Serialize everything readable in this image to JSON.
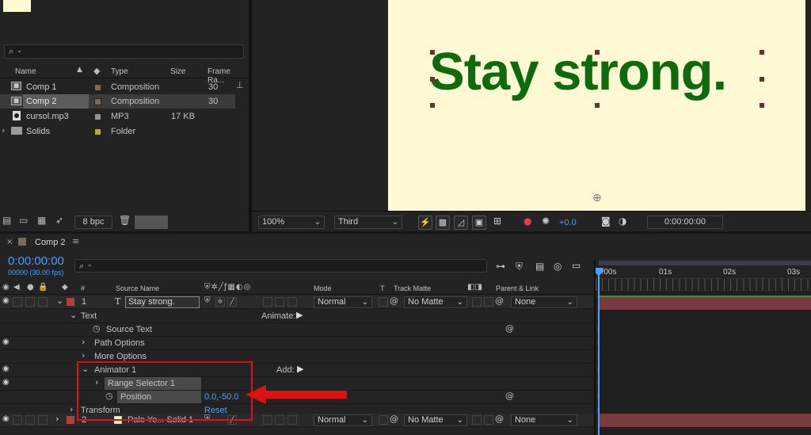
{
  "project": {
    "search_placeholder": "",
    "columns": [
      "Name",
      "Type",
      "Size",
      "Frame Ra..."
    ],
    "items": [
      {
        "name": "Comp 1",
        "type": "Composition",
        "size": "",
        "fps": "30",
        "icon": "composition-icon",
        "label_color": "#7a6a58"
      },
      {
        "name": "Comp 2",
        "type": "Composition",
        "size": "",
        "fps": "30",
        "icon": "composition-icon",
        "label_color": "#7a6a58"
      },
      {
        "name": "cursol.mp3",
        "type": "MP3",
        "size": "17 KB",
        "fps": "",
        "icon": "audio-file-icon",
        "label_color": "#8a9a8a"
      },
      {
        "name": "Solids",
        "type": "Folder",
        "size": "",
        "fps": "",
        "icon": "folder-icon",
        "label_color": "#b8a832"
      }
    ],
    "bpc": "8 bpc"
  },
  "viewer": {
    "text": "Stay strong.",
    "bg_color": "#fff9d4",
    "text_color": "#0d6b0d",
    "zoom": "100%",
    "view": "Third",
    "exposure": "+0.0",
    "timecode": "0:00:00:00"
  },
  "timeline": {
    "tab": "Comp 2",
    "timecode": "0:00:00:00",
    "frames": "00000 (30.00 fps)",
    "headers": {
      "source_name": "Source Name",
      "mode": "Mode",
      "t": "T",
      "track_matte": "Track Matte",
      "parent": "Parent & Link",
      "num": "#"
    },
    "ruler": [
      "0:00s",
      "01s",
      "02s",
      "03s"
    ],
    "layers": [
      {
        "num": "1",
        "name": "Stay strong.",
        "mode": "Normal",
        "matte": "No Matte",
        "parent": "None"
      },
      {
        "num": "2",
        "name": "Pale Ye... Solid 1",
        "mode": "Normal",
        "matte": "No Matte",
        "parent": "None"
      }
    ],
    "props": {
      "text": "Text",
      "animate": "Animate:",
      "source_text": "Source Text",
      "path_options": "Path Options",
      "more_options": "More Options",
      "animator": "Animator 1",
      "add": "Add:",
      "range_selector": "Range Selector 1",
      "position": "Position",
      "position_value": "0.0,-50.0",
      "transform": "Transform",
      "reset": "Reset"
    }
  }
}
